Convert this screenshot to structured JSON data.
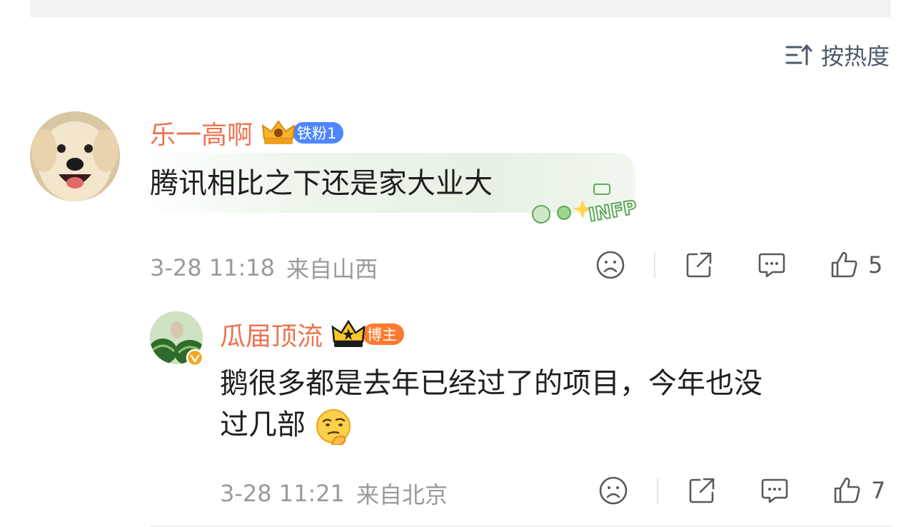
{
  "sort": {
    "label": "按热度",
    "icon": "sort-icon"
  },
  "comments": [
    {
      "username": "乐一高啊",
      "badge_label": "铁粉1",
      "badge_color": "#4d86ff",
      "text": "腾讯相比之下还是家大业大",
      "decoration_label": "INFP",
      "time": "3-28 11:18",
      "location": "来自山西",
      "like_count": "5"
    },
    {
      "username": "瓜届顶流",
      "badge_label": "博主",
      "badge_color": "#ff7a2e",
      "text_line1": "鹅很多都是去年已经过了的项目，今年也没",
      "text_line2": "过几部",
      "time": "3-28 11:21",
      "location": "来自北京",
      "like_count": "7"
    }
  ],
  "colors": {
    "username": "#eb7350",
    "meta": "#9a9a9a",
    "icon": "#5a5a5a"
  }
}
